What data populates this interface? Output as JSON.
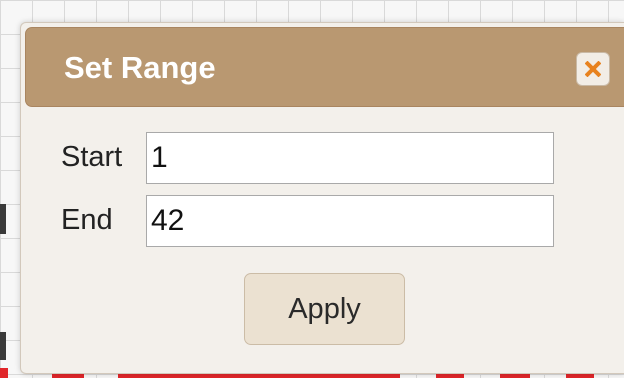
{
  "dialog": {
    "title": "Set Range",
    "close_icon": "close-icon",
    "fields": {
      "start": {
        "label": "Start",
        "value": "1"
      },
      "end": {
        "label": "End",
        "value": "42"
      }
    },
    "apply_label": "Apply"
  },
  "colors": {
    "titlebar": "#b99871",
    "dialog_background": "#f3f0eb",
    "close_icon": "#e8821e",
    "button": "#ebe1d1"
  }
}
